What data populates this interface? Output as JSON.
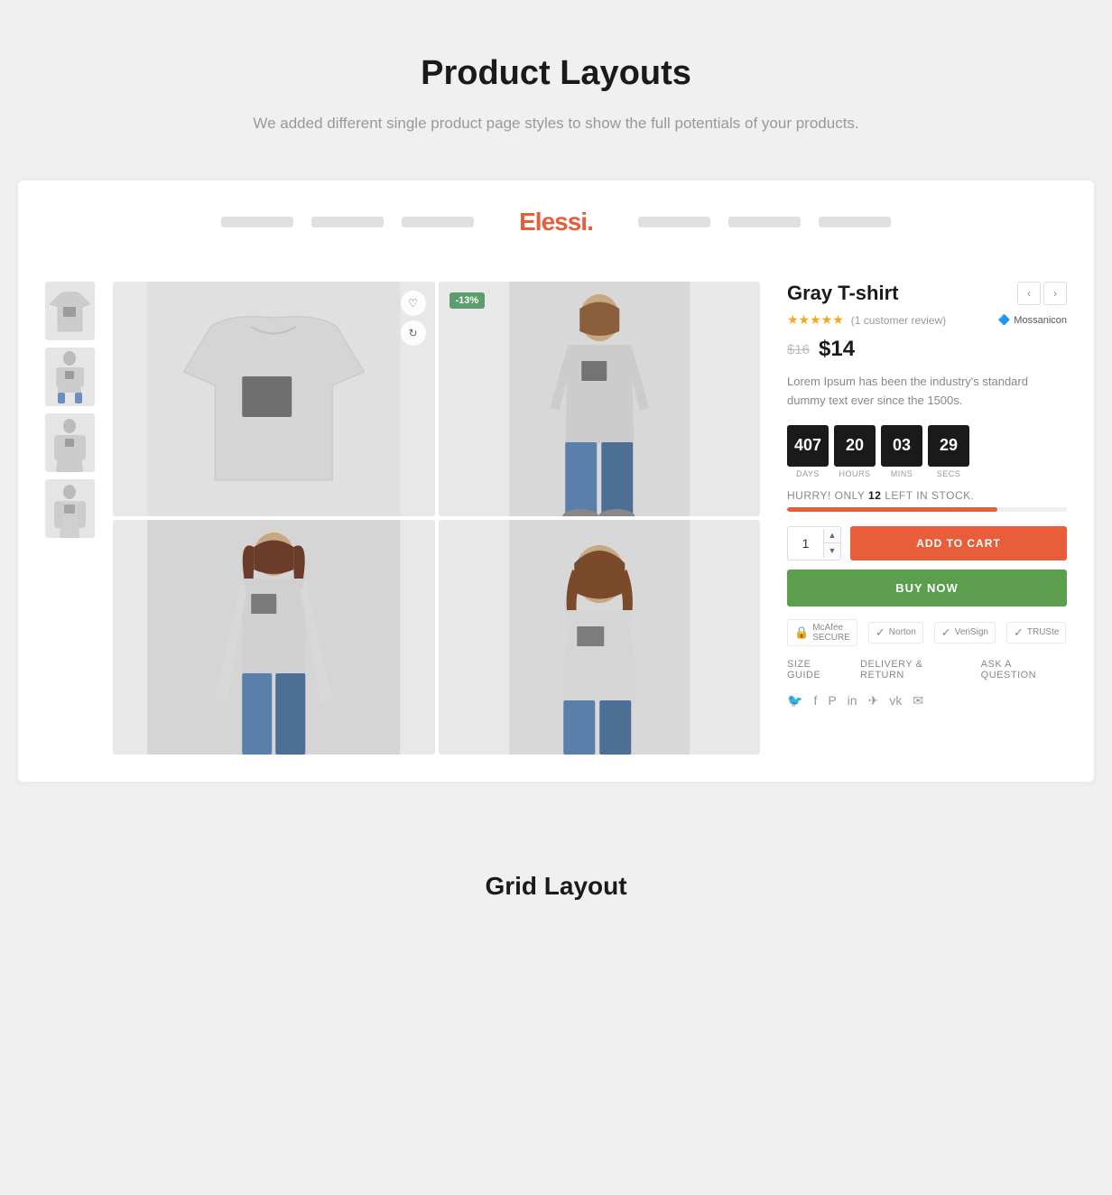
{
  "header": {
    "title": "Product Layouts",
    "subtitle": "We added different single product page styles to show the full potentials of your products."
  },
  "brand": {
    "name": "Elessi",
    "dot": "."
  },
  "navbar": {
    "placeholders": [
      "",
      "",
      "",
      "",
      "",
      ""
    ]
  },
  "product": {
    "title": "Gray T-shirt",
    "rating": "★★★★★",
    "rating_text": "(1 customer review)",
    "brand_name": "Mossanicon",
    "price_old": "$16",
    "price_new": "$14",
    "description": "Lorem Ipsum has been the industry's standard dummy text ever since the 1500s.",
    "countdown": {
      "days": "407",
      "hours": "20",
      "mins": "03",
      "secs": "29",
      "days_label": "DAYS",
      "hours_label": "HOURS",
      "mins_label": "MINS",
      "secs_label": "SECS"
    },
    "stock_text_prefix": "HURRY! ONLY",
    "stock_count": "12",
    "stock_text_suffix": "LEFT IN STOCK.",
    "qty": "1",
    "btn_cart": "ADD TO CART",
    "btn_buy": "BUY NOW",
    "trust_badges": [
      {
        "icon": "🔒",
        "label": "McAfee SECURE"
      },
      {
        "icon": "✓",
        "label": "Norton"
      },
      {
        "icon": "✓",
        "label": "VeriSign"
      },
      {
        "icon": "✓",
        "label": "TRUSte"
      }
    ],
    "links": [
      "SIZE GUIDE",
      "DELIVERY & RETURN",
      "ASK A QUESTION"
    ],
    "badge_discount": "-13%",
    "discount_label": "-13%"
  },
  "grid_layout": {
    "title": "Grid Layout"
  },
  "icons": {
    "heart": "♡",
    "refresh": "↻",
    "prev_arrow": "‹",
    "next_arrow": "›",
    "twitter": "🐦",
    "facebook": "f",
    "pinterest": "P",
    "linkedin": "in",
    "telegram": "✈",
    "vk": "vk",
    "mail": "✉"
  }
}
